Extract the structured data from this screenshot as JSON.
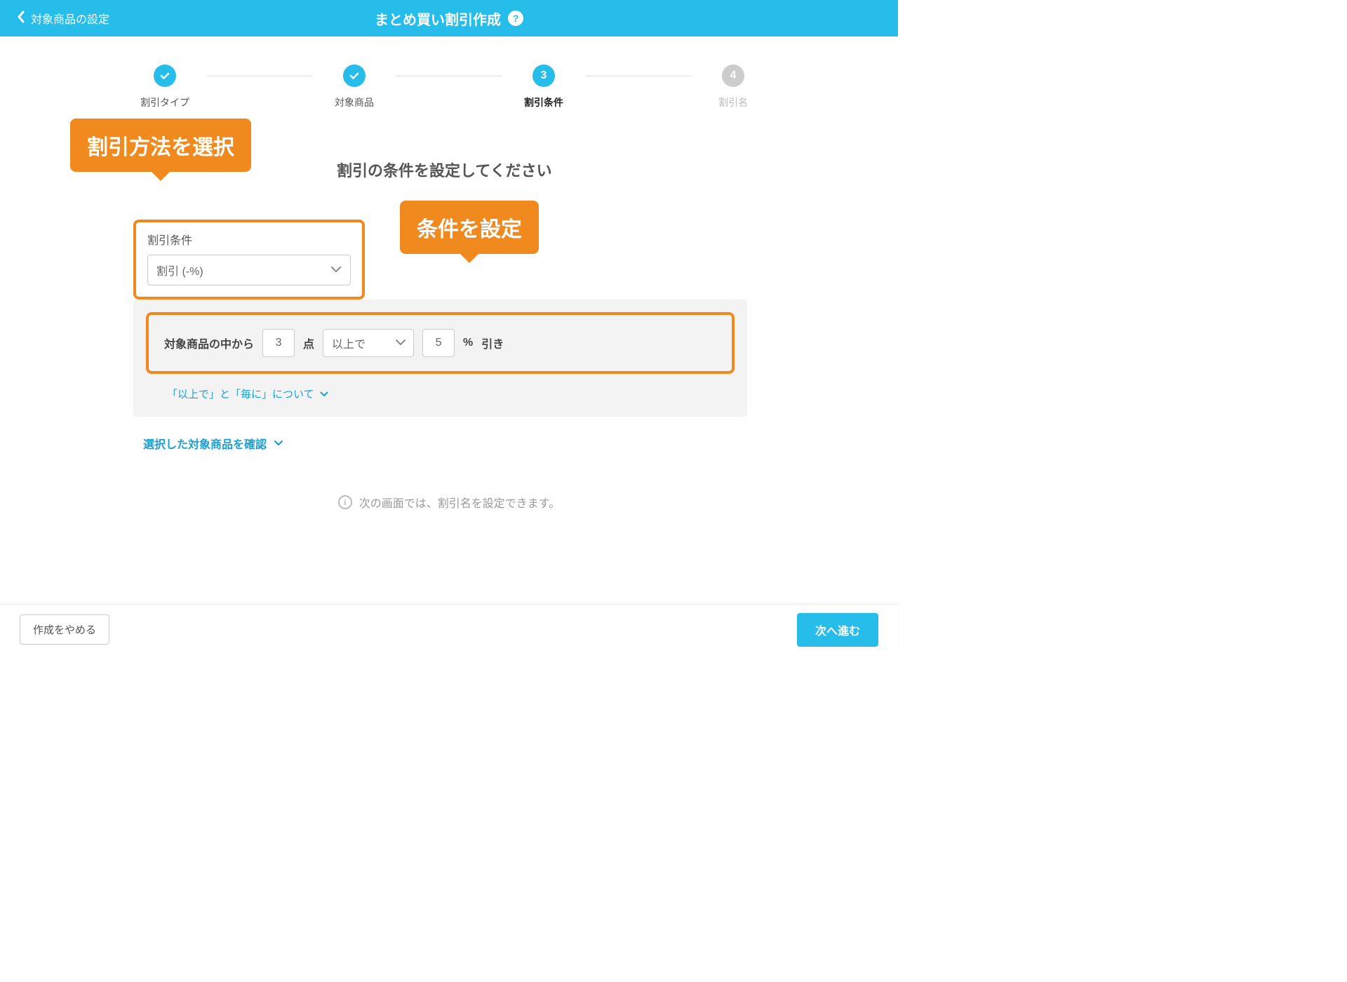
{
  "header": {
    "back_label": "対象商品の設定",
    "title": "まとめ買い割引作成",
    "help_glyph": "?"
  },
  "stepper": {
    "steps": [
      {
        "label": "割引タイプ",
        "state": "done"
      },
      {
        "label": "対象商品",
        "state": "done"
      },
      {
        "label": "割引条件",
        "state": "active",
        "num": "3"
      },
      {
        "label": "割引名",
        "state": "pending",
        "num": "4"
      }
    ]
  },
  "callouts": {
    "method": "割引方法を選択",
    "condition": "条件を設定"
  },
  "main": {
    "heading": "割引の条件を設定してください",
    "condition_label": "割引条件",
    "condition_select_value": "割引 (-%)",
    "rule": {
      "prefix": "対象商品の中から",
      "qty_value": "3",
      "qty_unit": "点",
      "operator_value": "以上で",
      "percent_value": "5",
      "percent_unit": "%",
      "suffix": "引き"
    },
    "about_link": "「以上で」と「毎に」について",
    "confirm_link": "選択した対象商品を確認",
    "info_text": "次の画面では、割引名を設定できます。"
  },
  "footer": {
    "cancel": "作成をやめる",
    "next": "次へ進む"
  }
}
